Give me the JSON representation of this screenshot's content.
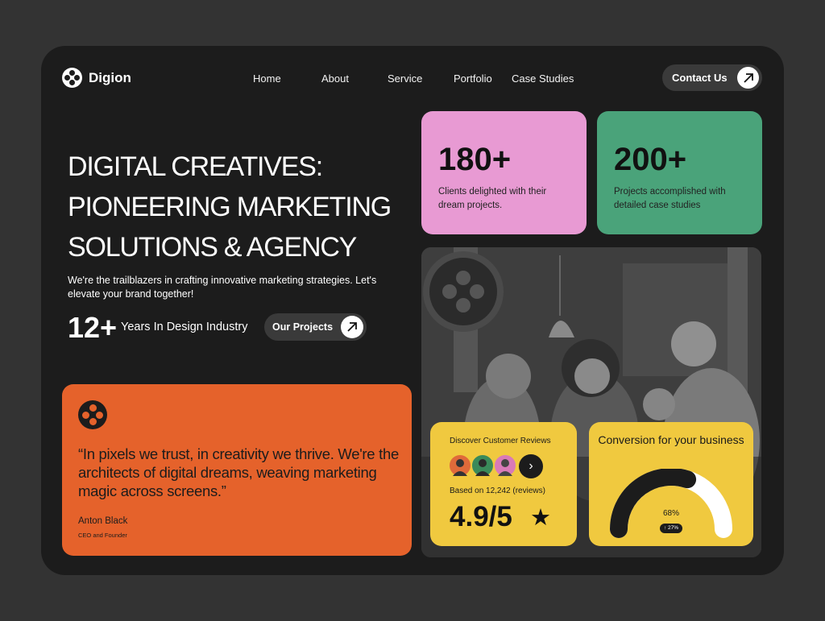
{
  "brand": {
    "name": "Digion"
  },
  "nav": {
    "items": [
      {
        "label": "Home"
      },
      {
        "label": "About"
      },
      {
        "label": "Service"
      },
      {
        "label": "Portfolio"
      },
      {
        "label": "Case Studies"
      }
    ],
    "contact_label": "Contact Us"
  },
  "hero": {
    "title_lines": [
      "DIGITAL CREATIVES:",
      "PIONEERING MARKETING",
      "SOLUTIONS & AGENCY"
    ],
    "subtitle": "We're the trailblazers in crafting innovative marketing strategies. Let's elevate your brand together!",
    "years_value": "12+",
    "years_label": "Years In Design Industry",
    "projects_button": "Our Projects"
  },
  "quote": {
    "text": "“In pixels we trust, in creativity we thrive. We're the architects of digital dreams, weaving marketing magic across screens.”",
    "author": "Anton Black",
    "role": "CEO and Founder"
  },
  "stats": [
    {
      "value": "180+",
      "description": "Clients delighted with their dream projects.",
      "color": "#e89ad3"
    },
    {
      "value": "200+",
      "description": "Projects accomplished with detailed case studies",
      "color": "#4aa37a"
    }
  ],
  "reviews": {
    "title": "Discover Customer Reviews",
    "based_on": "Based on 12,242 (reviews)",
    "rating": "4.9/5",
    "avatars": [
      {
        "name": "reviewer-avatar-1",
        "color": "#e06a3a"
      },
      {
        "name": "reviewer-avatar-2",
        "color": "#3a8a5a"
      },
      {
        "name": "reviewer-avatar-3",
        "color": "#d97ab8"
      }
    ]
  },
  "conversion": {
    "title": "Conversion for your business",
    "percent": "68%",
    "badge": "↑ 27%",
    "value": 0.68
  },
  "colors": {
    "background": "#333333",
    "frame": "#1c1c1c",
    "orange": "#e5622b",
    "pink": "#e89ad3",
    "green": "#4aa37a",
    "yellow": "#f0c93f"
  },
  "icons": [
    "logo-icon",
    "arrow-up-right-icon",
    "chevron-right-icon",
    "star-icon"
  ]
}
